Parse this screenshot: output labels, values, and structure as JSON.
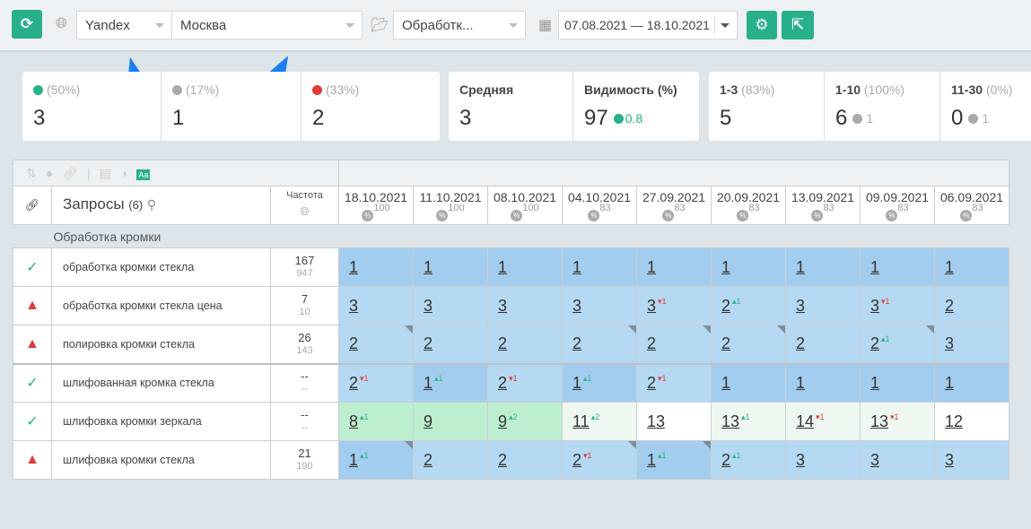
{
  "toolbar": {
    "engine": "Yandex",
    "region": "Москва",
    "group": "Обработк...",
    "date_range": "07.08.2021 — 18.10.2021"
  },
  "colors": {
    "accent": "#27b08a",
    "up": "#27b08a",
    "down": "#e03a3a",
    "rank_top": "#a3cdee",
    "rank_good": "#b5d9f2",
    "rank_mid": "#bdeed0",
    "rank_light": "#eef8f1",
    "annotation_arrow": "#1a7ff0"
  },
  "stats": [
    {
      "pct": "(50%)",
      "value": "3",
      "icon": "arrow-up-circle"
    },
    {
      "pct": "(17%)",
      "value": "1",
      "icon": "minus-circle"
    },
    {
      "pct": "(33%)",
      "value": "2",
      "icon": "arrow-down-circle"
    }
  ],
  "avg": {
    "label": "Средняя",
    "value": "3"
  },
  "visibility": {
    "label": "Видимость (%)",
    "value": "97",
    "delta": "0.8"
  },
  "tops": [
    {
      "label": "1-3",
      "pct": "(83%)",
      "value": "5",
      "delta": ""
    },
    {
      "label": "1-10",
      "pct": "(100%)",
      "value": "6",
      "delta": "1",
      "dir": "up"
    },
    {
      "label": "11-30",
      "pct": "(0%)",
      "value": "0",
      "delta": "1",
      "dir": "down"
    }
  ],
  "table": {
    "queries_label": "Запросы",
    "queries_count": "(6)",
    "freq_label": "Частота",
    "dates": [
      {
        "d": "18.10.2021",
        "p": "100"
      },
      {
        "d": "11.10.2021",
        "p": "100"
      },
      {
        "d": "08.10.2021",
        "p": "100"
      },
      {
        "d": "04.10.2021",
        "p": "83"
      },
      {
        "d": "27.09.2021",
        "p": "83"
      },
      {
        "d": "20.09.2021",
        "p": "83"
      },
      {
        "d": "13.09.2021",
        "p": "83"
      },
      {
        "d": "09.09.2021",
        "p": "83"
      },
      {
        "d": "06.09.2021",
        "p": "83"
      }
    ],
    "group": "Обработка кромки",
    "rows": [
      {
        "status": "ok",
        "query": "обработка кромки стекла",
        "f1": "167",
        "f2": "947",
        "cells": [
          [
            "1"
          ],
          [
            "1"
          ],
          [
            "1"
          ],
          [
            "1"
          ],
          [
            "1"
          ],
          [
            "1"
          ],
          [
            "1"
          ],
          [
            "1"
          ],
          [
            "1"
          ]
        ]
      },
      {
        "status": "warn",
        "query": "обработка кромки стекла цена",
        "f1": "7",
        "f2": "10",
        "cells": [
          [
            "3"
          ],
          [
            "3"
          ],
          [
            "3"
          ],
          [
            "3"
          ],
          [
            "3",
            "-1"
          ],
          [
            "2",
            "+1"
          ],
          [
            "3"
          ],
          [
            "3",
            "-1"
          ],
          [
            "2"
          ]
        ]
      },
      {
        "status": "warn",
        "query": "полировка кромки стекла",
        "f1": "26",
        "f2": "143",
        "cells": [
          [
            "2",
            "",
            1
          ],
          [
            "2"
          ],
          [
            "2"
          ],
          [
            "2",
            "",
            1
          ],
          [
            "2",
            "",
            1
          ],
          [
            "2",
            "",
            1
          ],
          [
            "2"
          ],
          [
            "2",
            "+1",
            1
          ],
          [
            "3"
          ]
        ]
      },
      {
        "status": "ok",
        "query": "шлифованная кромка стекла",
        "f1": "--",
        "f2": "--",
        "cells": [
          [
            "2",
            "-1"
          ],
          [
            "1",
            "+1"
          ],
          [
            "2",
            "-1"
          ],
          [
            "1",
            "+1"
          ],
          [
            "2",
            "-1"
          ],
          [
            "1"
          ],
          [
            "1"
          ],
          [
            "1"
          ],
          [
            "1"
          ]
        ]
      },
      {
        "status": "ok",
        "query": "шлифовка кромки зеркала",
        "f1": "--",
        "f2": "--",
        "cells": [
          [
            "8",
            "+1"
          ],
          [
            "9"
          ],
          [
            "9",
            "+2"
          ],
          [
            "11",
            "+2"
          ],
          [
            "13"
          ],
          [
            "13",
            "+1"
          ],
          [
            "14",
            "-1"
          ],
          [
            "13",
            "-1"
          ],
          [
            "12"
          ]
        ]
      },
      {
        "status": "warn",
        "query": "шлифовка кромки стекла",
        "f1": "21",
        "f2": "190",
        "cells": [
          [
            "1",
            "+1",
            1
          ],
          [
            "2"
          ],
          [
            "2"
          ],
          [
            "2",
            "-1",
            1
          ],
          [
            "1",
            "+1",
            1
          ],
          [
            "2",
            "+1"
          ],
          [
            "3"
          ],
          [
            "3"
          ],
          [
            "3"
          ]
        ]
      }
    ]
  }
}
